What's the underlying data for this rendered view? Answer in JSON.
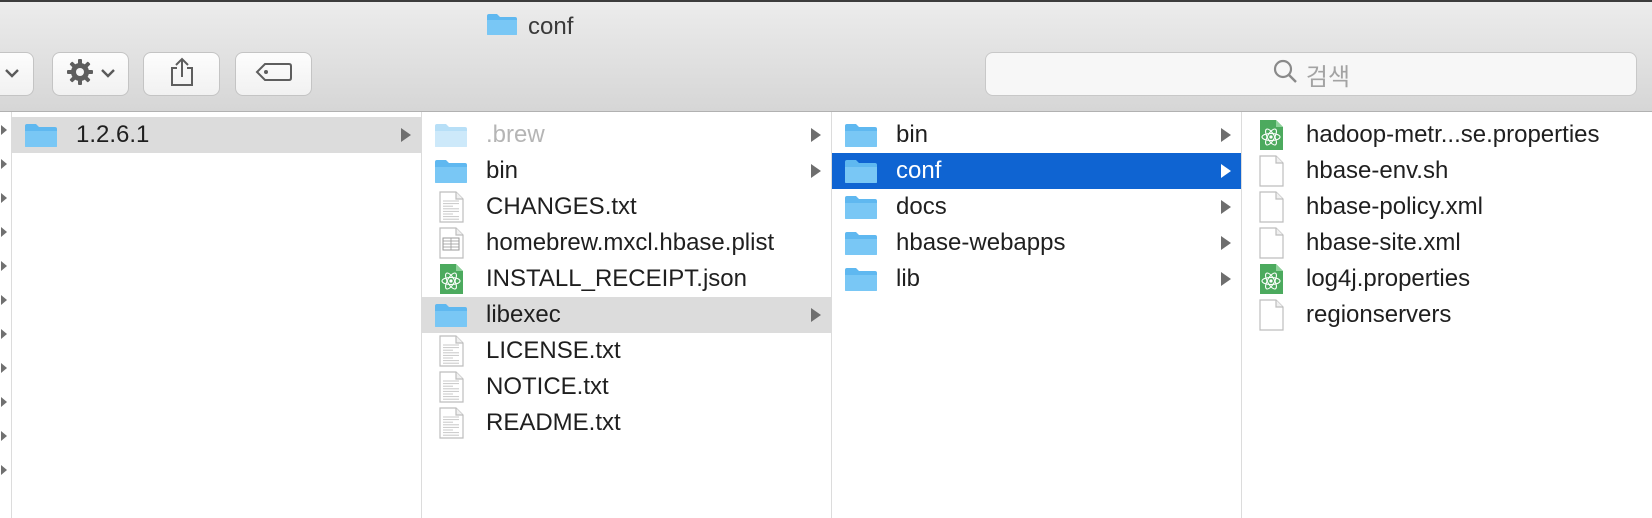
{
  "window": {
    "title": "conf"
  },
  "toolbar": {
    "search_placeholder": "검색"
  },
  "columns": [
    {
      "items": [
        {
          "label": "1.2.6.1",
          "type": "folder",
          "state": "gray",
          "has_children": true
        }
      ]
    },
    {
      "items": [
        {
          "label": ".brew",
          "type": "folder",
          "state": "dim",
          "has_children": true
        },
        {
          "label": "bin",
          "type": "folder",
          "state": "",
          "has_children": true
        },
        {
          "label": "CHANGES.txt",
          "type": "text-file",
          "state": "",
          "has_children": false
        },
        {
          "label": "homebrew.mxcl.hbase.plist",
          "type": "plist-file",
          "state": "",
          "has_children": false
        },
        {
          "label": "INSTALL_RECEIPT.json",
          "type": "atom-file",
          "state": "",
          "has_children": false
        },
        {
          "label": "libexec",
          "type": "folder",
          "state": "gray",
          "has_children": true
        },
        {
          "label": "LICENSE.txt",
          "type": "text-file",
          "state": "",
          "has_children": false
        },
        {
          "label": "NOTICE.txt",
          "type": "text-file",
          "state": "",
          "has_children": false
        },
        {
          "label": "README.txt",
          "type": "text-file",
          "state": "",
          "has_children": false
        }
      ]
    },
    {
      "items": [
        {
          "label": "bin",
          "type": "folder",
          "state": "",
          "has_children": true
        },
        {
          "label": "conf",
          "type": "folder",
          "state": "sel",
          "has_children": true
        },
        {
          "label": "docs",
          "type": "folder",
          "state": "",
          "has_children": true
        },
        {
          "label": "hbase-webapps",
          "type": "folder",
          "state": "",
          "has_children": true
        },
        {
          "label": "lib",
          "type": "folder",
          "state": "",
          "has_children": true
        }
      ]
    },
    {
      "items": [
        {
          "label": "hadoop-metr...se.properties",
          "type": "atom-file",
          "state": "",
          "has_children": false
        },
        {
          "label": "hbase-env.sh",
          "type": "blank-file",
          "state": "",
          "has_children": false
        },
        {
          "label": "hbase-policy.xml",
          "type": "blank-file",
          "state": "",
          "has_children": false
        },
        {
          "label": "hbase-site.xml",
          "type": "blank-file",
          "state": "",
          "has_children": false
        },
        {
          "label": "log4j.properties",
          "type": "atom-file",
          "state": "",
          "has_children": false
        },
        {
          "label": "regionservers",
          "type": "blank-file",
          "state": "",
          "has_children": false
        }
      ]
    }
  ],
  "colors": {
    "selection": "#0f64d2",
    "folder": "#5fb8f0",
    "atom_icon": "#4caa5e"
  }
}
